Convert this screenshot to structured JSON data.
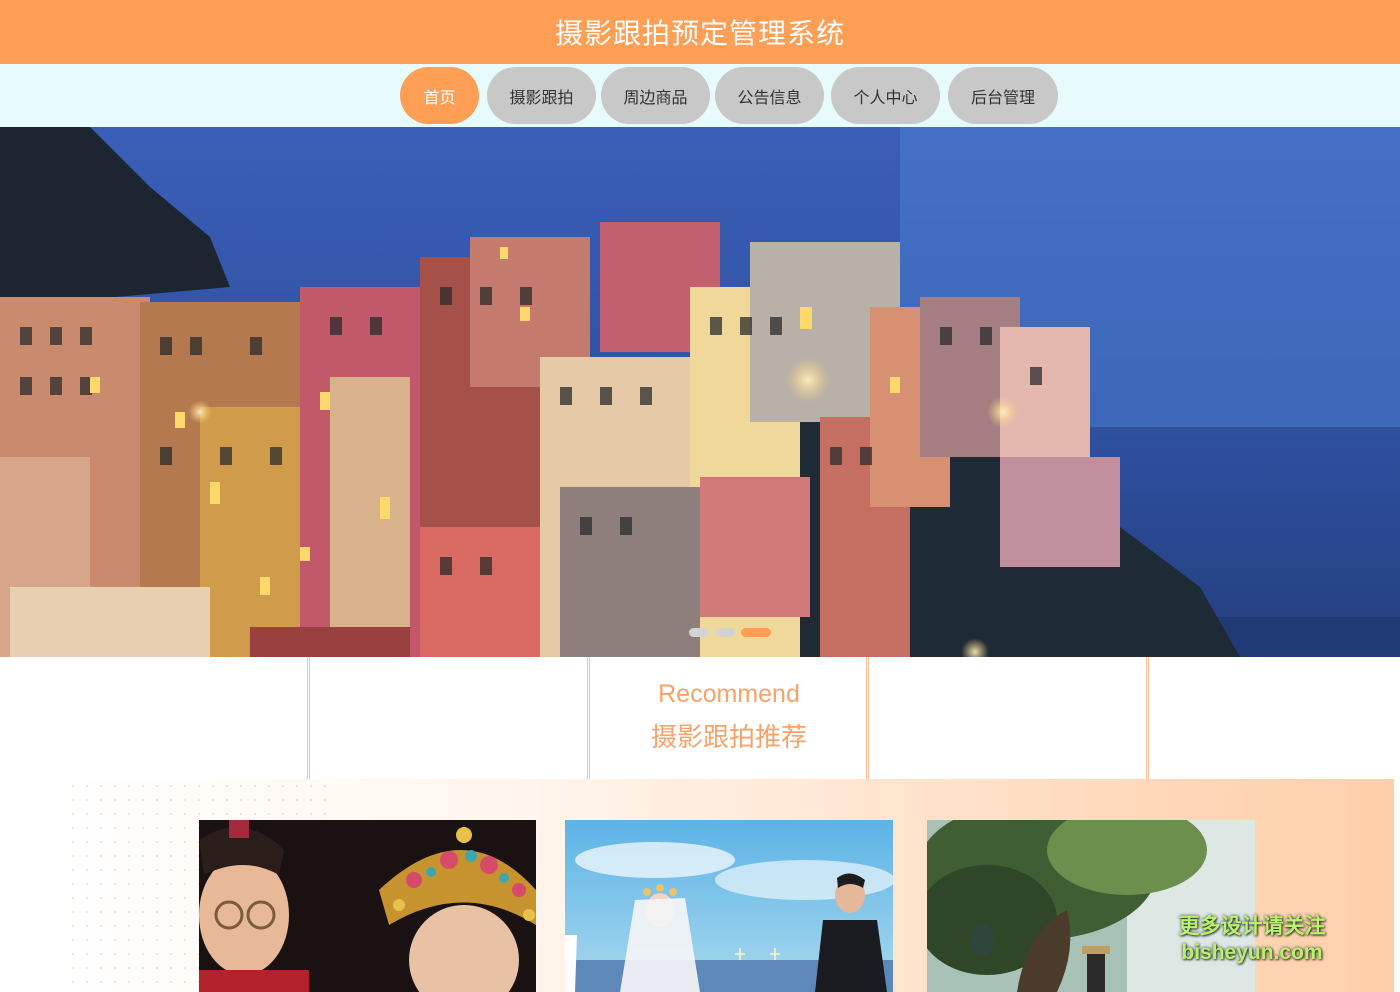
{
  "header": {
    "title": "摄影跟拍预定管理系统"
  },
  "nav": {
    "items": [
      {
        "label": "首页",
        "active": true
      },
      {
        "label": "摄影跟拍",
        "active": false
      },
      {
        "label": "周边商品",
        "active": false
      },
      {
        "label": "公告信息",
        "active": false
      },
      {
        "label": "个人中心",
        "active": false
      },
      {
        "label": "后台管理",
        "active": false
      }
    ]
  },
  "banner": {
    "slide_count": 3,
    "active_slide": 3
  },
  "recommend": {
    "title_en": "Recommend",
    "title_zh": "摄影跟拍推荐",
    "cards": [
      {
        "image": "traditional-chinese-wedding-photo"
      },
      {
        "image": "seaside-wedding-photo"
      },
      {
        "image": "forest-outdoor-photo"
      }
    ]
  },
  "watermark": {
    "line1": "更多设计请关注",
    "line2": "bisheyun.com"
  },
  "colors": {
    "accent": "#FF9F55",
    "nav_bg": "#E8FBFC",
    "nav_inactive": "#C8C8C8",
    "section_text": "#F5A36A"
  }
}
